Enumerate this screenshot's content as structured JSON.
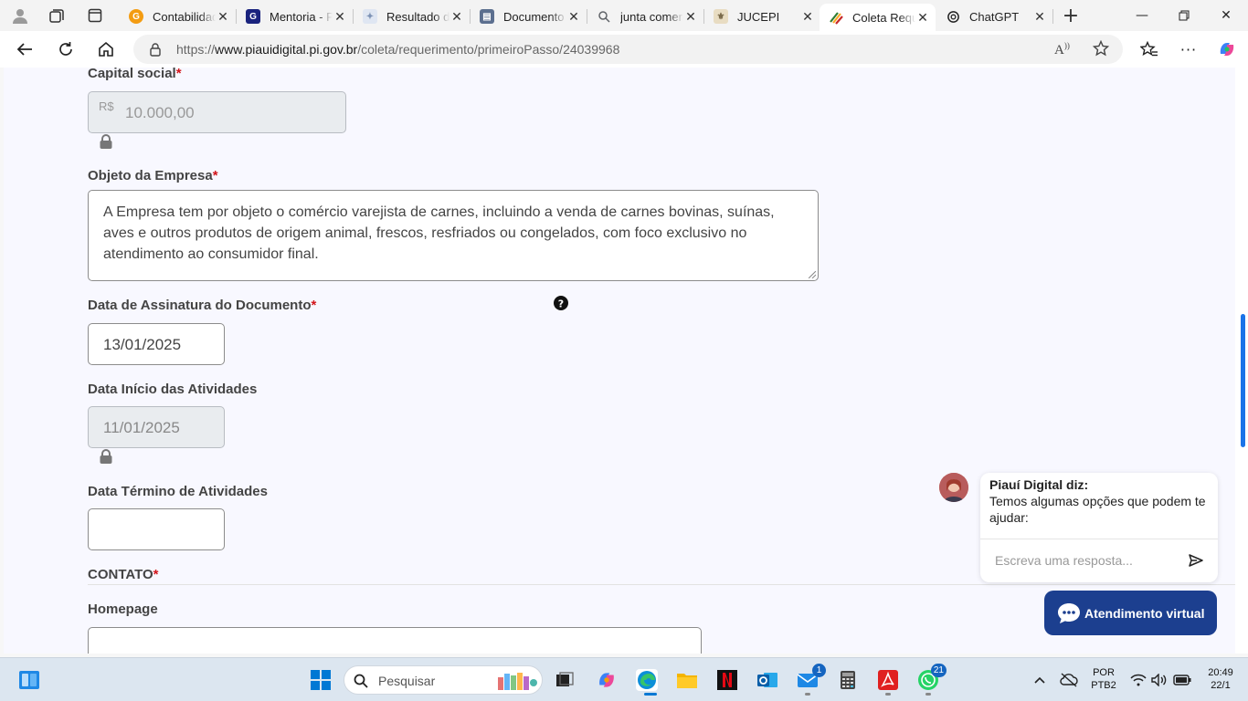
{
  "browser": {
    "tabs": [
      {
        "label": "Contabilidade",
        "favicon": "contabilidade-favicon",
        "color": "#f39c12"
      },
      {
        "label": "Mentoria - Plataforma",
        "favicon": "mentoria-favicon",
        "color": "#1a237e"
      },
      {
        "label": "Resultado da pesquisa",
        "favicon": "resultado-favicon",
        "color": "#7e93b5"
      },
      {
        "label": "Documento",
        "favicon": "documento-favicon",
        "color": "#5c6f8f"
      },
      {
        "label": "junta comercial",
        "favicon": "search-favicon",
        "color": "#5f6368"
      },
      {
        "label": "JUCEPI",
        "favicon": "jucepi-favicon",
        "color": "#c8b89a"
      },
      {
        "label": "Coleta Requerimento",
        "favicon": "piaui-digital-favicon",
        "color": "#2e7d32"
      },
      {
        "label": "ChatGPT",
        "favicon": "chatgpt-favicon",
        "color": "#222222"
      }
    ],
    "active_tab_index": 6,
    "url_prefix": "https://",
    "url_host": "www.piauidigital.pi.gov.br",
    "url_path": "/coleta/requerimento/primeiroPasso/24039968"
  },
  "form": {
    "capital_social": {
      "label": "Capital social",
      "required_mark": "*",
      "currency_prefix": "R$",
      "value": "10.000,00"
    },
    "objeto": {
      "label": "Objeto da Empresa",
      "required_mark": "*",
      "value": "A Empresa tem por objeto o comércio varejista de carnes, incluindo a venda de carnes bovinas, suínas, aves e outros produtos de origem animal, frescos, resfriados ou congelados, com foco exclusivo no atendimento ao consumidor final."
    },
    "data_assinatura": {
      "label": "Data de Assinatura do Documento",
      "required_mark": "*",
      "value": "13/01/2025",
      "help_icon": "question-circle-icon"
    },
    "data_inicio": {
      "label": "Data Início das Atividades",
      "value": "11/01/2025"
    },
    "data_termino": {
      "label": "Data Término de Atividades",
      "value": ""
    },
    "contato": {
      "label": "CONTATO",
      "required_mark": "*"
    },
    "homepage": {
      "label": "Homepage",
      "value": ""
    }
  },
  "chat": {
    "title": "Piauí Digital diz:",
    "message": "Temos algumas opções que podem te ajudar:",
    "input_placeholder": "Escreva uma resposta...",
    "button_label": "Atendimento virtual"
  },
  "taskbar": {
    "search_placeholder": "Pesquisar",
    "outlook_badge": "1",
    "whatsapp_badge": "21",
    "lang_top": "POR",
    "lang_bottom": "PTB2",
    "time": "20:49",
    "date": "22/1"
  },
  "colors": {
    "required": "#d2151b",
    "chat_button": "#1c3f8f",
    "scroll_thumb": "#1a73e8"
  }
}
